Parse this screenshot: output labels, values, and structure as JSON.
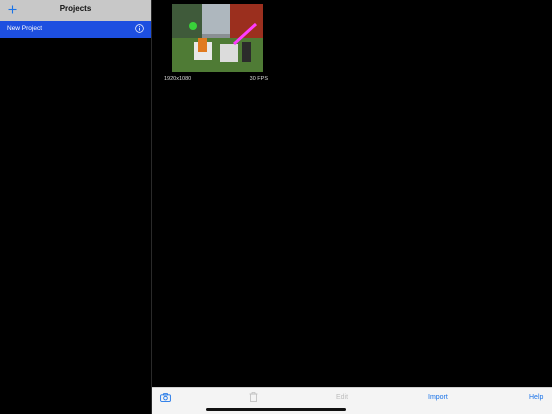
{
  "sidebar": {
    "title": "Projects",
    "add_icon": "plus-icon",
    "project": {
      "label": "New Project",
      "info_icon": "info-circle-icon"
    }
  },
  "clip": {
    "resolution": "1920x1080",
    "fps": "30 FPS"
  },
  "toolbar": {
    "camera_icon": "camera-icon",
    "trash_icon": "trash-icon",
    "edit_label": "Edit",
    "import_label": "Import",
    "help_label": "Help"
  },
  "colors": {
    "accent": "#1a73e8",
    "selection": "#1d4fe0",
    "header": "#c8c8c8"
  }
}
